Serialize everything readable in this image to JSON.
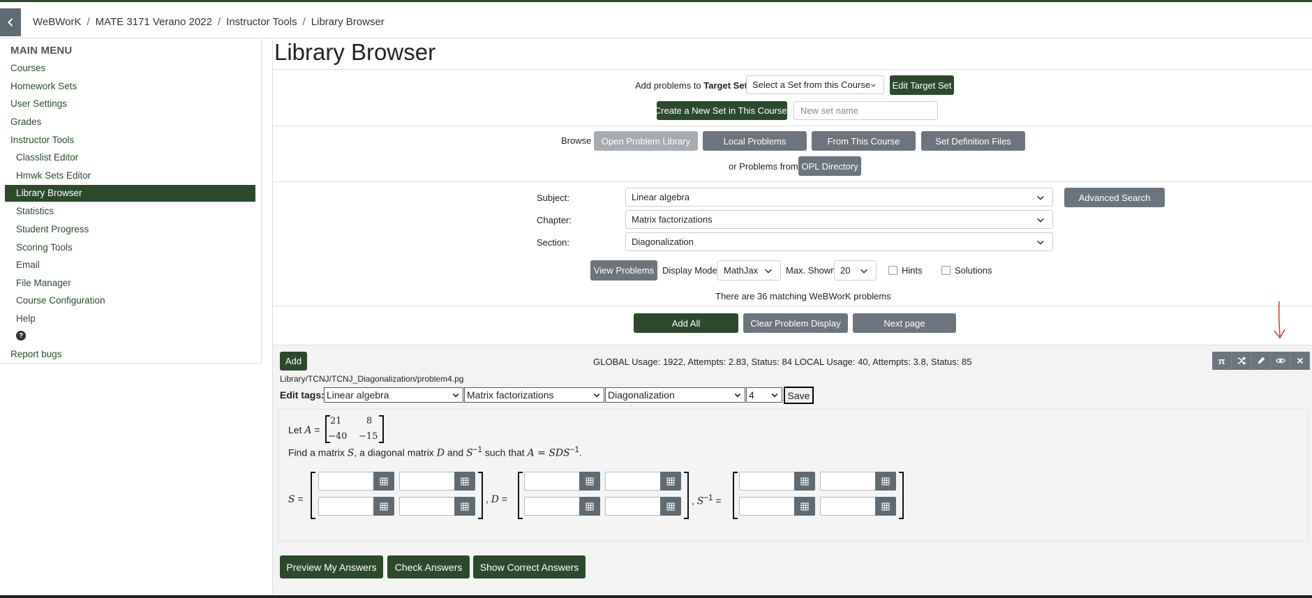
{
  "breadcrumb": [
    "WeBWorK",
    "MATE 3171 Verano 2022",
    "Instructor Tools",
    "Library Browser"
  ],
  "sidebar": {
    "title": "MAIN MENU",
    "items": [
      {
        "label": "Courses"
      },
      {
        "label": "Homework Sets"
      },
      {
        "label": "User Settings"
      },
      {
        "label": "Grades"
      },
      {
        "label": "Instructor Tools"
      },
      {
        "label": "Classlist Editor"
      },
      {
        "label": "Hmwk Sets Editor"
      },
      {
        "label": "Library Browser"
      },
      {
        "label": "Statistics"
      },
      {
        "label": "Student Progress"
      },
      {
        "label": "Scoring Tools"
      },
      {
        "label": "Email"
      },
      {
        "label": "File Manager"
      },
      {
        "label": "Course Configuration"
      },
      {
        "label": "Help"
      },
      {
        "label": "?"
      },
      {
        "label": "Report bugs"
      }
    ]
  },
  "page_title": "Library Browser",
  "target": {
    "add_label": "Add problems to",
    "target_label": "Target Set:",
    "select_value": "Select a Set from this Course",
    "edit_button": "Edit Target Set",
    "create_button": "Create a New Set in This Course:",
    "new_set_placeholder": "New set name"
  },
  "browse": {
    "label": "Browse",
    "buttons": [
      "Open Problem Library",
      "Local Problems",
      "From This Course",
      "Set Definition Files"
    ],
    "or_label": "or Problems from",
    "opl_button": "OPL Directory"
  },
  "filters": {
    "subject_label": "Subject:",
    "subject_value": "Linear algebra",
    "chapter_label": "Chapter:",
    "chapter_value": "Matrix factorizations",
    "section_label": "Section:",
    "section_value": "Diagonalization",
    "advanced_button": "Advanced Search",
    "view_button": "View Problems",
    "display_mode_label": "Display Mode:",
    "display_mode_value": "MathJax",
    "max_shown_label": "Max. Shown:",
    "max_shown_value": "20",
    "hints_label": "Hints",
    "solutions_label": "Solutions",
    "matching_text": "There are 36 matching WeBWorK problems"
  },
  "actions": {
    "add_all": "Add All",
    "clear": "Clear Problem Display",
    "next": "Next page"
  },
  "problem": {
    "add_button": "Add",
    "usage": "GLOBAL Usage: 1922, Attempts: 2.83, Status: 84  LOCAL Usage: 40, Attempts: 3.8, Status: 85",
    "path": "Library/TCNJ/TCNJ_Diagonalization/problem4.pg",
    "edit_tags_label": "Edit tags:",
    "tags": [
      "Linear algebra",
      "Matrix factorizations",
      "Diagonalization",
      "4"
    ],
    "save_button": "Save",
    "icons": [
      "pi-icon",
      "shuffle-icon",
      "pencil-icon",
      "eye-icon",
      "close-icon"
    ],
    "statement_let": "Let",
    "matrix_a": [
      [
        "21",
        "8"
      ],
      [
        "−40",
        "−15"
      ]
    ],
    "find_text_1": "Find a matrix",
    "find_text_2": ", a diagonal matrix",
    "find_text_3": "and",
    "find_text_4": "such that",
    "var_a": "A",
    "var_s": "S",
    "var_d": "D",
    "var_sinv": "S",
    "sup_minus1": "−1",
    "equation": "A = SDS",
    "eq_sign": " = ",
    "answer_buttons": [
      "Preview My Answers",
      "Check Answers",
      "Show Correct Answers"
    ]
  },
  "colors": {
    "brand": "#2c4a2b",
    "gray_button": "#6c757d",
    "disabled_button": "#a6acb1",
    "annotation": "#e03030"
  }
}
